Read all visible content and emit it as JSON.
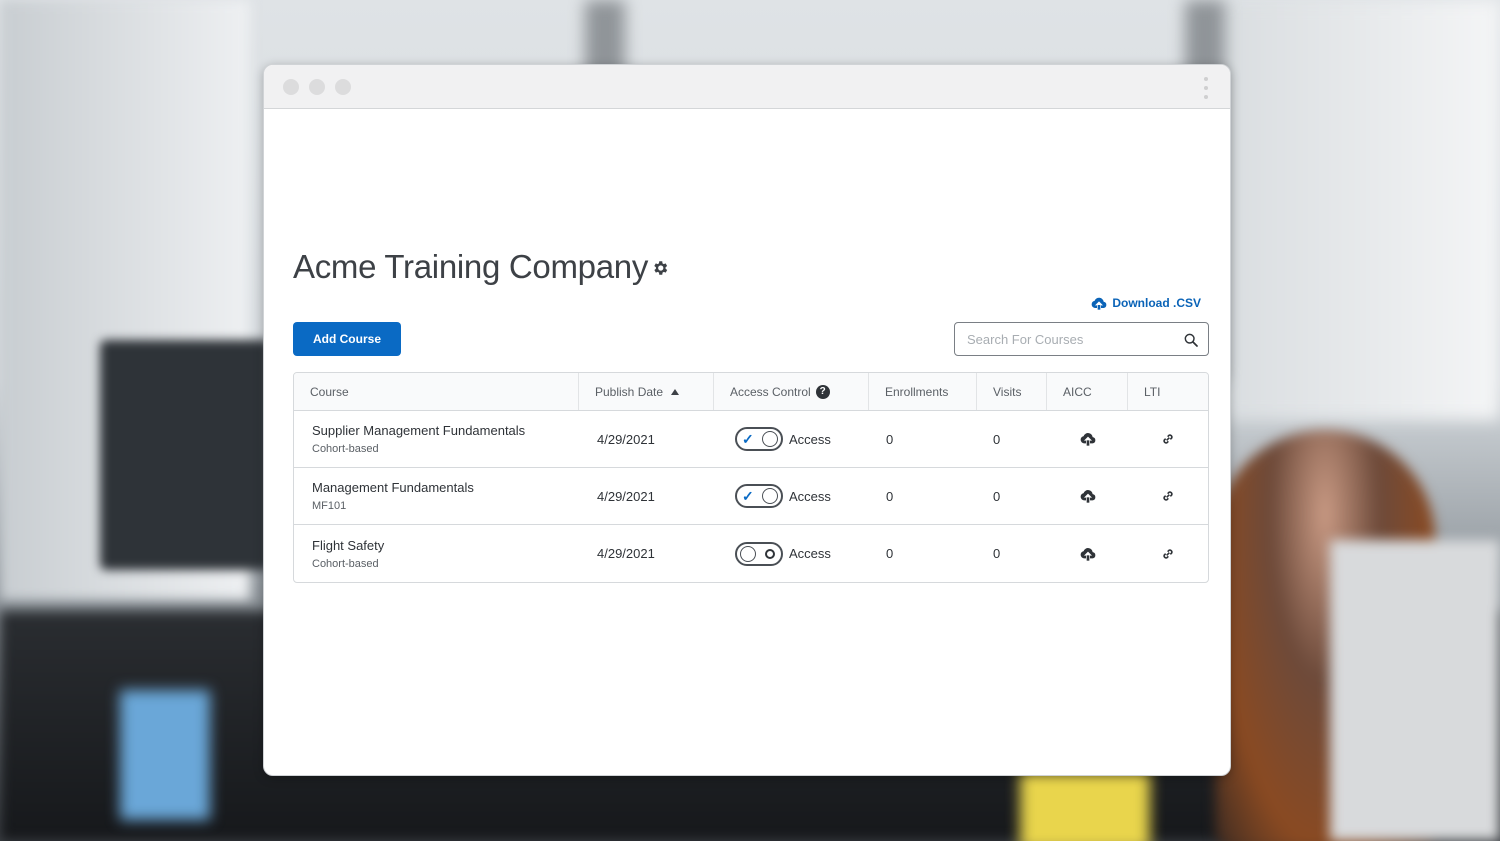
{
  "page": {
    "title": "Acme Training Company",
    "download_label": "Download .CSV",
    "add_course_label": "Add Course",
    "search_placeholder": "Search For Courses"
  },
  "table": {
    "headers": {
      "course": "Course",
      "publish_date": "Publish Date",
      "access_control": "Access Control",
      "enrollments": "Enrollments",
      "visits": "Visits",
      "aicc": "AICC",
      "lti": "LTI"
    },
    "rows": [
      {
        "name": "Supplier Management Fundamentals",
        "subtitle": "Cohort-based",
        "publish_date": "4/29/2021",
        "access_on": true,
        "access_label": "Access",
        "enrollments": "0",
        "visits": "0"
      },
      {
        "name": "Management Fundamentals",
        "subtitle": "MF101",
        "publish_date": "4/29/2021",
        "access_on": true,
        "access_label": "Access",
        "enrollments": "0",
        "visits": "0"
      },
      {
        "name": "Flight Safety",
        "subtitle": "Cohort-based",
        "publish_date": "4/29/2021",
        "access_on": false,
        "access_label": "Access",
        "enrollments": "0",
        "visits": "0"
      }
    ]
  },
  "icons": {
    "settings": "gear-icon",
    "download": "cloud-upload-icon",
    "search": "search-icon",
    "sort": "sort-ascending-icon",
    "help": "help-icon",
    "aicc": "cloud-upload-icon",
    "lti": "link-icon"
  },
  "colors": {
    "accent": "#0a6ac4",
    "link": "#0a63b7",
    "text": "#2f3338"
  }
}
